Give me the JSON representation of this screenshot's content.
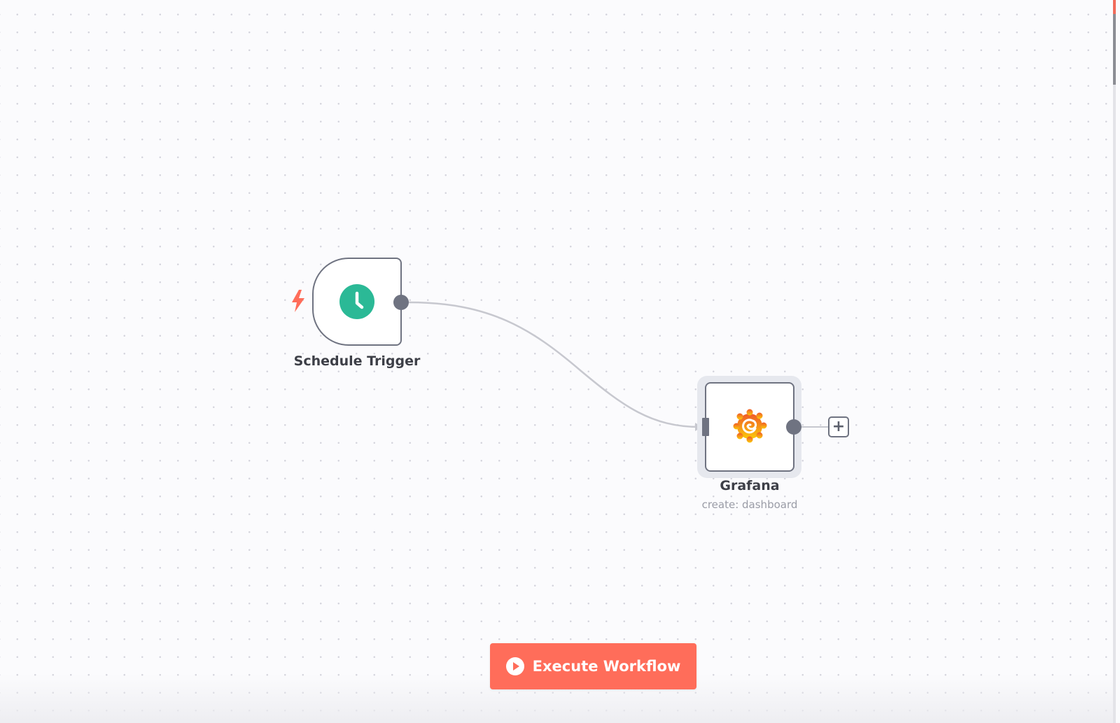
{
  "canvas": {
    "background": "dotted-grid"
  },
  "nodes": [
    {
      "id": "schedule-trigger",
      "name": "Schedule Trigger",
      "subtitle": "",
      "icon": "clock-icon",
      "icon_color": "#2bb996",
      "is_trigger": true,
      "trigger_badge_icon": "lightning-bolt-icon",
      "trigger_badge_color": "#ff6d5a"
    },
    {
      "id": "grafana",
      "name": "Grafana",
      "subtitle": "create: dashboard",
      "icon": "grafana-logo-icon",
      "selected": true
    }
  ],
  "connections": [
    {
      "from": "Schedule Trigger",
      "to": "Grafana"
    }
  ],
  "add_node_button": {
    "label": "+",
    "icon": "plus-icon"
  },
  "toolbar": {
    "execute_label": "Execute Workflow",
    "execute_icon": "play-circle-icon",
    "execute_color": "#ff6d5a"
  },
  "colors": {
    "node_border": "#6f7381",
    "edge": "#c7c8cf",
    "accent": "#ff6d5a"
  }
}
